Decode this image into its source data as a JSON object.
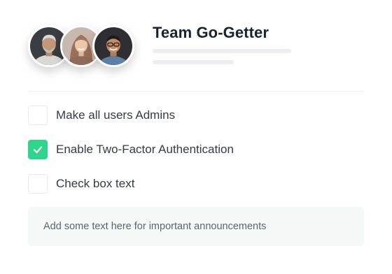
{
  "team": {
    "name": "Team Go-Getter",
    "avatars": [
      {
        "icon": "avatar-person-gray-beard"
      },
      {
        "icon": "avatar-person-woman"
      },
      {
        "icon": "avatar-person-glasses"
      }
    ]
  },
  "options": [
    {
      "label": "Make all users Admins",
      "checked": false
    },
    {
      "label": "Enable Two-Factor Authentication",
      "checked": true
    },
    {
      "label": "Check box text",
      "checked": false
    }
  ],
  "announcement": {
    "text": "Add some text here for important announcements"
  },
  "colors": {
    "accent": "#2fd68a",
    "announcement_bg": "#f4f9f7",
    "placeholder": "#eceef2"
  }
}
